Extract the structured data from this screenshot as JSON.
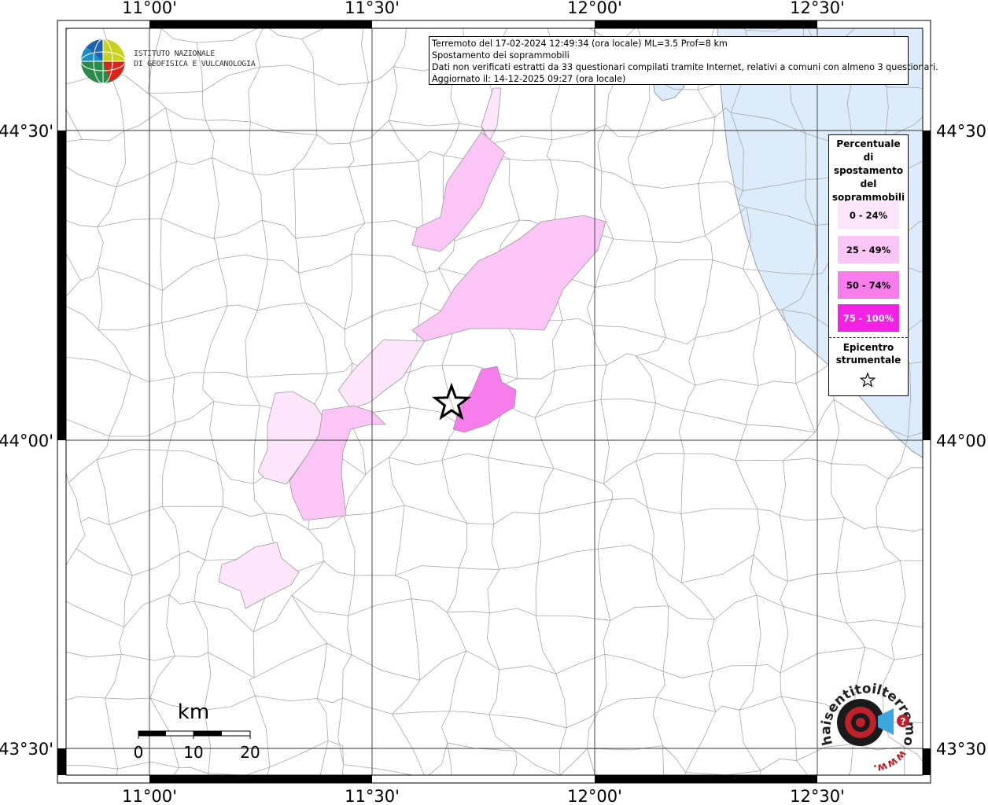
{
  "info": {
    "line1": "Terremoto del 17-02-2024 12:49:34 (ora locale) ML=3.5 Prof=8 km",
    "line2": "Spostamento dei soprammobili",
    "line3": "Dati non verificati estratti da 33 questionari compilati tramite Internet, relativi a comuni con almeno 3 questionari.",
    "line4": "Aggiornato il: 14-12-2025 09:27 (ora locale)"
  },
  "axes": {
    "lon_top": [
      "11°00'",
      "11°30'",
      "12°00'",
      "12°30'"
    ],
    "lon_bottom": [
      "11°00'",
      "11°30'",
      "12°00'",
      "12°30'"
    ],
    "lat_left": [
      "44°30'",
      "44°00'",
      "43°30'"
    ],
    "lat_right": [
      "44°30'",
      "44°00'",
      "43°30'"
    ]
  },
  "legend": {
    "title_lines": [
      "Percentuale",
      "di",
      "spostamento",
      "del",
      "soprammobili"
    ],
    "classes": [
      {
        "label": "0 - 24%",
        "color": "#fde6fb"
      },
      {
        "label": "25 - 49%",
        "color": "#fbc6f5"
      },
      {
        "label": "50 - 74%",
        "color": "#f77cec"
      },
      {
        "label": "75 - 100%",
        "color": "#f320e6"
      }
    ],
    "epicenter_lines": [
      "Epicentro",
      "strumentale"
    ]
  },
  "scale": {
    "unit": "km",
    "labels": [
      "0",
      "10",
      "20"
    ]
  },
  "logos": {
    "ingv_line1": "ISTITUTO NAZIONALE",
    "ingv_line2": "DI GEOFISICA E VULCANOLOGIA",
    "hst_text": "haisentitoilterremoto.it",
    "hst_www": "www."
  },
  "colors": {
    "sea": "#dcecfa",
    "border": "#a8a8a8",
    "frame": "#000000"
  }
}
